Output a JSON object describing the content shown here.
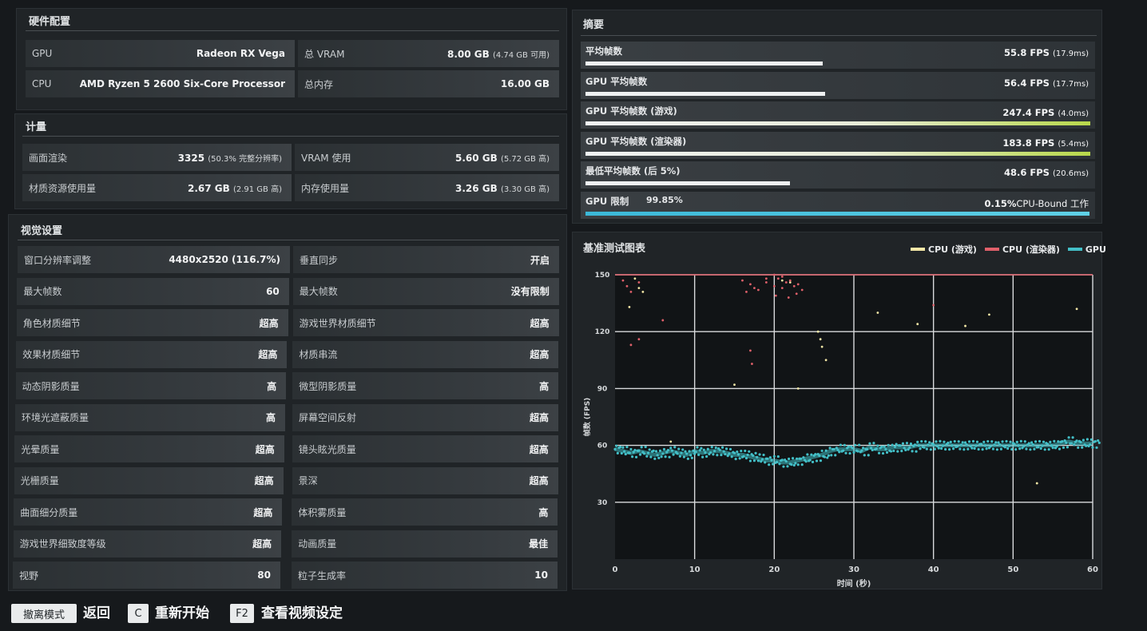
{
  "hardware": {
    "title": "硬件配置",
    "rows": [
      {
        "label": "GPU",
        "value": "Radeon RX Vega",
        "label2": "总 VRAM",
        "value2": "8.00 GB",
        "value2_sub": "(4.74 GB 可用)"
      },
      {
        "label": "CPU",
        "value": "AMD Ryzen 5 2600 Six-Core Processor",
        "label2": "总内存",
        "value2": "16.00 GB",
        "value2_sub": ""
      }
    ]
  },
  "metrics": {
    "title": "计量",
    "rows": [
      {
        "label": "画面渲染",
        "value": "3325",
        "value_sub": "(50.3% 完整分辨率)",
        "label2": "VRAM 使用",
        "value2": "5.60 GB",
        "value2_sub": "(5.72 GB 高)"
      },
      {
        "label": "材质资源使用量",
        "value": "2.67 GB",
        "value_sub": "(2.91 GB 高)",
        "label2": "内存使用量",
        "value2": "3.26 GB",
        "value2_sub": "(3.30 GB 高)"
      }
    ]
  },
  "visual": {
    "title": "视觉设置",
    "rows": [
      {
        "label": "窗口分辨率调整",
        "value": "4480x2520 (116.7%)",
        "label2": "垂直同步",
        "value2": "开启"
      },
      {
        "label": "最大帧数",
        "value": "60",
        "label2": "最大帧数",
        "value2": "没有限制"
      },
      {
        "label": "角色材质细节",
        "value": "超高",
        "label2": "游戏世界材质细节",
        "value2": "超高"
      },
      {
        "label": "效果材质细节",
        "value": "超高",
        "label2": "材质串流",
        "value2": "超高"
      },
      {
        "label": "动态阴影质量",
        "value": "高",
        "label2": "微型阴影质量",
        "value2": "高"
      },
      {
        "label": "环境光遮蔽质量",
        "value": "高",
        "label2": "屏幕空间反射",
        "value2": "超高"
      },
      {
        "label": "光晕质量",
        "value": "超高",
        "label2": "镜头眩光质量",
        "value2": "超高"
      },
      {
        "label": "光栅质量",
        "value": "超高",
        "label2": "景深",
        "value2": "超高"
      },
      {
        "label": "曲面细分质量",
        "value": "超高",
        "label2": "体积雾质量",
        "value2": "高"
      },
      {
        "label": "游戏世界细致度等级",
        "value": "超高",
        "label2": "动画质量",
        "value2": "最佳"
      },
      {
        "label": "视野",
        "value": "80",
        "label2": "粒子生成率",
        "value2": "10"
      }
    ]
  },
  "summary": {
    "title": "摘要",
    "rows": [
      {
        "label": "平均帧数",
        "value": "55.8 FPS",
        "value_sub": "(17.9ms)",
        "fill": 0.47,
        "bar": "#eef0f1"
      },
      {
        "label": "GPU 平均帧数",
        "value": "56.4 FPS",
        "value_sub": "(17.7ms)",
        "fill": 0.475,
        "bar": "#eef0f1"
      },
      {
        "label": "GPU 平均帧数 (游戏)",
        "value": "247.4 FPS",
        "value_sub": "(4.0ms)",
        "fill": 1.0,
        "bar": "gradient-yg"
      },
      {
        "label": "GPU 平均帧数 (渲染器)",
        "value": "183.8 FPS",
        "value_sub": "(5.4ms)",
        "fill": 1.0,
        "bar": "gradient-yg"
      },
      {
        "label": "最低平均帧数 (后 5%)",
        "value": "48.6 FPS",
        "value_sub": "(20.6ms)",
        "fill": 0.405,
        "bar": "#eef0f1"
      }
    ],
    "gpu_limit": {
      "label": "GPU 限制",
      "percent": "99.85%",
      "cpu_bound_value": "0.15%",
      "cpu_bound_label": "CPU-Bound 工作",
      "fill": 0.9985
    }
  },
  "chart_data": {
    "type": "scatter",
    "title": "基准测试图表",
    "xlabel": "时间 (秒)",
    "ylabel": "帧数 (FPS)",
    "xlim": [
      0,
      60
    ],
    "ylim": [
      0,
      150
    ],
    "x_ticks": [
      0,
      10,
      20,
      30,
      40,
      50,
      60
    ],
    "y_ticks": [
      30,
      60,
      90,
      120,
      150
    ],
    "y_tick_labels": [
      "30",
      "60",
      "90",
      "120",
      "150"
    ],
    "cap_line": 150,
    "grid": true,
    "legend_position": "top-right",
    "series": [
      {
        "name": "CPU (游戏)",
        "color": "#f3e7a6",
        "note": "mostly above 150 (off chart)",
        "points": [
          [
            2.5,
            148
          ],
          [
            3,
            143
          ],
          [
            3.5,
            141
          ],
          [
            1.8,
            133
          ],
          [
            21,
            147
          ],
          [
            22,
            146
          ],
          [
            25.5,
            120
          ],
          [
            25.8,
            116
          ],
          [
            26,
            112
          ],
          [
            33,
            130
          ],
          [
            38,
            124
          ],
          [
            44,
            123
          ],
          [
            47,
            129
          ],
          [
            58,
            132
          ],
          [
            15,
            92
          ],
          [
            23,
            90
          ],
          [
            26.5,
            105
          ],
          [
            7,
            62
          ],
          [
            53,
            40
          ]
        ]
      },
      {
        "name": "CPU (渲染器)",
        "color": "#e0606a",
        "points": [
          [
            1,
            147
          ],
          [
            1.5,
            144
          ],
          [
            2,
            141
          ],
          [
            3,
            146
          ],
          [
            16,
            147
          ],
          [
            17,
            145
          ],
          [
            18,
            142
          ],
          [
            19,
            146
          ],
          [
            20,
            144
          ],
          [
            20.5,
            148
          ],
          [
            21,
            143
          ],
          [
            21.5,
            146
          ],
          [
            22,
            147
          ],
          [
            22.5,
            144
          ],
          [
            23,
            145
          ],
          [
            23.5,
            142
          ],
          [
            20,
            150
          ],
          [
            21,
            149
          ],
          [
            19,
            148
          ],
          [
            17.5,
            143
          ],
          [
            16.5,
            141
          ],
          [
            20.2,
            139
          ],
          [
            21.8,
            138
          ],
          [
            22.8,
            140
          ],
          [
            2,
            113
          ],
          [
            3,
            116
          ],
          [
            17,
            110
          ],
          [
            17.2,
            103
          ],
          [
            6,
            126
          ],
          [
            40,
            134
          ]
        ]
      },
      {
        "name": "GPU",
        "color": "#43bfc7",
        "points": [
          [
            0,
            58
          ],
          [
            1,
            57
          ],
          [
            2,
            56
          ],
          [
            3,
            57
          ],
          [
            4,
            56
          ],
          [
            5,
            55
          ],
          [
            6,
            56
          ],
          [
            7,
            57
          ],
          [
            8,
            56
          ],
          [
            9,
            55
          ],
          [
            10,
            57
          ],
          [
            11,
            56
          ],
          [
            12,
            57
          ],
          [
            13,
            57
          ],
          [
            14,
            56
          ],
          [
            15,
            55
          ],
          [
            16,
            55
          ],
          [
            17,
            54
          ],
          [
            18,
            53
          ],
          [
            19,
            52
          ],
          [
            20,
            52
          ],
          [
            21,
            51
          ],
          [
            22,
            51
          ],
          [
            23,
            52
          ],
          [
            24,
            53
          ],
          [
            25,
            54
          ],
          [
            26,
            55
          ],
          [
            27,
            57
          ],
          [
            28,
            58
          ],
          [
            29,
            58
          ],
          [
            30,
            58
          ],
          [
            31,
            57
          ],
          [
            32,
            59
          ],
          [
            33,
            58
          ],
          [
            34,
            58
          ],
          [
            35,
            59
          ],
          [
            36,
            59
          ],
          [
            37,
            59
          ],
          [
            38,
            60
          ],
          [
            39,
            60
          ],
          [
            40,
            60
          ],
          [
            41,
            60
          ],
          [
            42,
            60
          ],
          [
            43,
            60
          ],
          [
            44,
            60
          ],
          [
            45,
            60
          ],
          [
            46,
            60
          ],
          [
            47,
            60
          ],
          [
            48,
            60
          ],
          [
            49,
            60
          ],
          [
            50,
            60
          ],
          [
            51,
            60
          ],
          [
            52,
            60
          ],
          [
            53,
            60
          ],
          [
            54,
            60
          ],
          [
            55,
            60
          ],
          [
            56,
            61
          ],
          [
            57,
            62
          ],
          [
            58,
            61
          ],
          [
            59,
            61
          ],
          [
            60,
            61
          ]
        ]
      }
    ]
  },
  "footer": {
    "esc_key": "撤离模式",
    "esc_label": "返回",
    "c_key": "C",
    "c_label": "重新开始",
    "f2_key": "F2",
    "f2_label": "查看视频设定"
  }
}
